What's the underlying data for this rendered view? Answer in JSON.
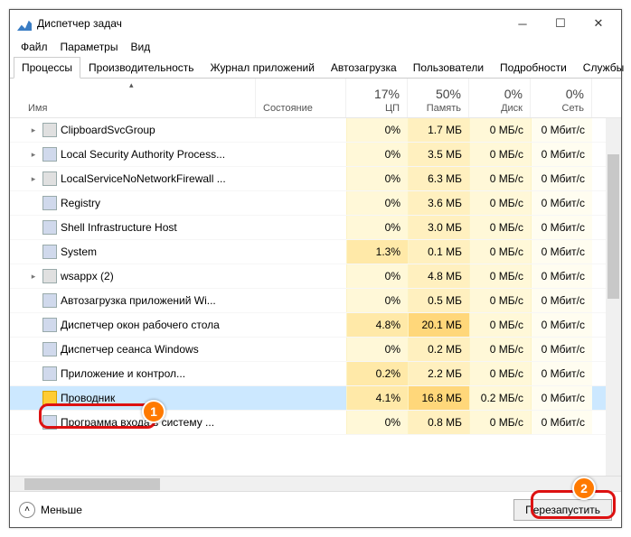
{
  "title": "Диспетчер задач",
  "menu": {
    "file": "Файл",
    "options": "Параметры",
    "view": "Вид"
  },
  "tabs": {
    "processes": "Процессы",
    "performance": "Производительность",
    "apphistory": "Журнал приложений",
    "startup": "Автозагрузка",
    "users": "Пользователи",
    "details": "Подробности",
    "services": "Службы"
  },
  "columns": {
    "name": "Имя",
    "status": "Состояние",
    "cpu": {
      "pct": "17%",
      "label": "ЦП"
    },
    "mem": {
      "pct": "50%",
      "label": "Память"
    },
    "disk": {
      "pct": "0%",
      "label": "Диск"
    },
    "net": {
      "pct": "0%",
      "label": "Сеть"
    }
  },
  "rows": [
    {
      "expand": true,
      "icon": "gear",
      "name": "ClipboardSvcGroup",
      "cpu": "0%",
      "mem": "1.7 МБ",
      "disk": "0 МБ/с",
      "net": "0 Мбит/с"
    },
    {
      "expand": true,
      "icon": "app",
      "name": "Local Security Authority Process...",
      "cpu": "0%",
      "mem": "3.5 МБ",
      "disk": "0 МБ/с",
      "net": "0 Мбит/с"
    },
    {
      "expand": true,
      "icon": "gear",
      "name": "LocalServiceNoNetworkFirewall ...",
      "cpu": "0%",
      "mem": "6.3 МБ",
      "disk": "0 МБ/с",
      "net": "0 Мбит/с"
    },
    {
      "expand": false,
      "icon": "app",
      "name": "Registry",
      "cpu": "0%",
      "mem": "3.6 МБ",
      "disk": "0 МБ/с",
      "net": "0 Мбит/с"
    },
    {
      "expand": false,
      "icon": "app",
      "name": "Shell Infrastructure Host",
      "cpu": "0%",
      "mem": "3.0 МБ",
      "disk": "0 МБ/с",
      "net": "0 Мбит/с"
    },
    {
      "expand": false,
      "icon": "app",
      "name": "System",
      "cpu": "1.3%",
      "mem": "0.1 МБ",
      "disk": "0 МБ/с",
      "net": "0 Мбит/с"
    },
    {
      "expand": true,
      "icon": "gear",
      "name": "wsappx (2)",
      "cpu": "0%",
      "mem": "4.8 МБ",
      "disk": "0 МБ/с",
      "net": "0 Мбит/с"
    },
    {
      "expand": false,
      "icon": "app",
      "name": "Автозагрузка приложений Wi...",
      "cpu": "0%",
      "mem": "0.5 МБ",
      "disk": "0 МБ/с",
      "net": "0 Мбит/с"
    },
    {
      "expand": false,
      "icon": "app",
      "name": "Диспетчер окон рабочего стола",
      "cpu": "4.8%",
      "mem": "20.1 МБ",
      "disk": "0 МБ/с",
      "net": "0 Мбит/с",
      "memHigh": true
    },
    {
      "expand": false,
      "icon": "app",
      "name": "Диспетчер сеанса  Windows",
      "cpu": "0%",
      "mem": "0.2 МБ",
      "disk": "0 МБ/с",
      "net": "0 Мбит/с"
    },
    {
      "expand": false,
      "icon": "app",
      "name": "Приложение         и контрол...",
      "cpu": "0.2%",
      "mem": "2.2 МБ",
      "disk": "0 МБ/с",
      "net": "0 Мбит/с"
    },
    {
      "expand": false,
      "icon": "f",
      "name": "Проводник",
      "cpu": "4.1%",
      "mem": "16.8 МБ",
      "disk": "0.2 МБ/с",
      "net": "0 Мбит/с",
      "selected": true,
      "memHigh": true
    },
    {
      "expand": false,
      "icon": "app",
      "name": "Программа входа в систему ...",
      "cpu": "0%",
      "mem": "0.8 МБ",
      "disk": "0 МБ/с",
      "net": "0 Мбит/с"
    }
  ],
  "footer": {
    "less": "Меньше",
    "restart": "Перезапустить"
  },
  "callouts": {
    "b1": "1",
    "b2": "2"
  }
}
